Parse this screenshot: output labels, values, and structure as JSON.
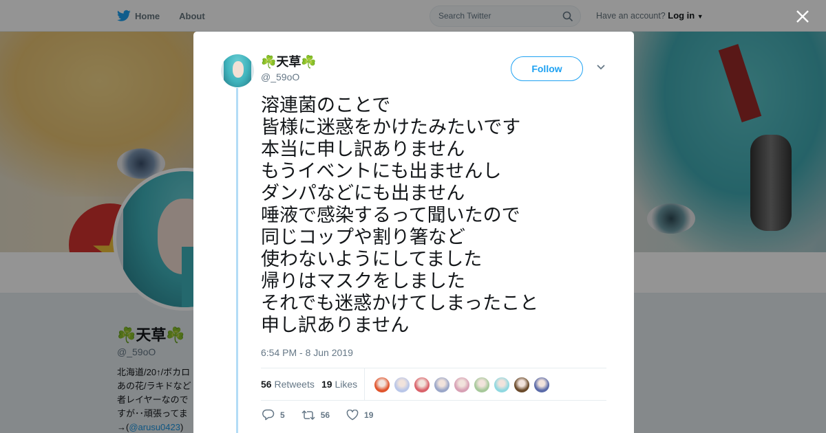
{
  "topbar": {
    "nav": [
      {
        "label": "Home",
        "icon": "twitter-bird-icon"
      },
      {
        "label": "About"
      }
    ],
    "search_placeholder": "Search Twitter",
    "account_prompt": "Have an account?",
    "login_label": "Log in"
  },
  "profile": {
    "name": "☘️天草☘️",
    "handle": "@_59oO",
    "bio_lines": [
      "北海道/20↑/ボカロ",
      "あの花/ラキドなど",
      "者レイヤーなので",
      "すが･･頑張ってま"
    ],
    "bio_link_prefix": "→(",
    "bio_link": "@arusu0423",
    "bio_link_suffix": ")"
  },
  "tweet": {
    "name": "☘️天草☘️",
    "handle": "@_59oO",
    "follow_label": "Follow",
    "text": "溶連菌のことで\n皆様に迷惑をかけたみたいです\n本当に申し訳ありません\nもうイベントにも出ませんし\nダンパなどにも出ません\n唾液で感染するって聞いたので\n同じコップや割り箸など\n使わないようにしてました\n帰りはマスクをしました\nそれでも迷惑かけてしまったこと\n申し訳ありません",
    "timestamp": "6:54 PM - 8 Jun 2019",
    "retweets_count": "56",
    "retweets_label": "Retweets",
    "likes_count": "19",
    "likes_label": "Likes",
    "liker_colors": [
      "#e0542c",
      "#b9c6e8",
      "#d9626a",
      "#9aa6c8",
      "#d7a0b4",
      "#a6c89a",
      "#8fd8e0",
      "#6a4a2a",
      "#5a6aa8"
    ],
    "actions": {
      "replies": "5",
      "retweets": "56",
      "likes": "19"
    }
  },
  "colors": {
    "accent": "#1da1f2",
    "thread_line": "#b3dcf6"
  }
}
